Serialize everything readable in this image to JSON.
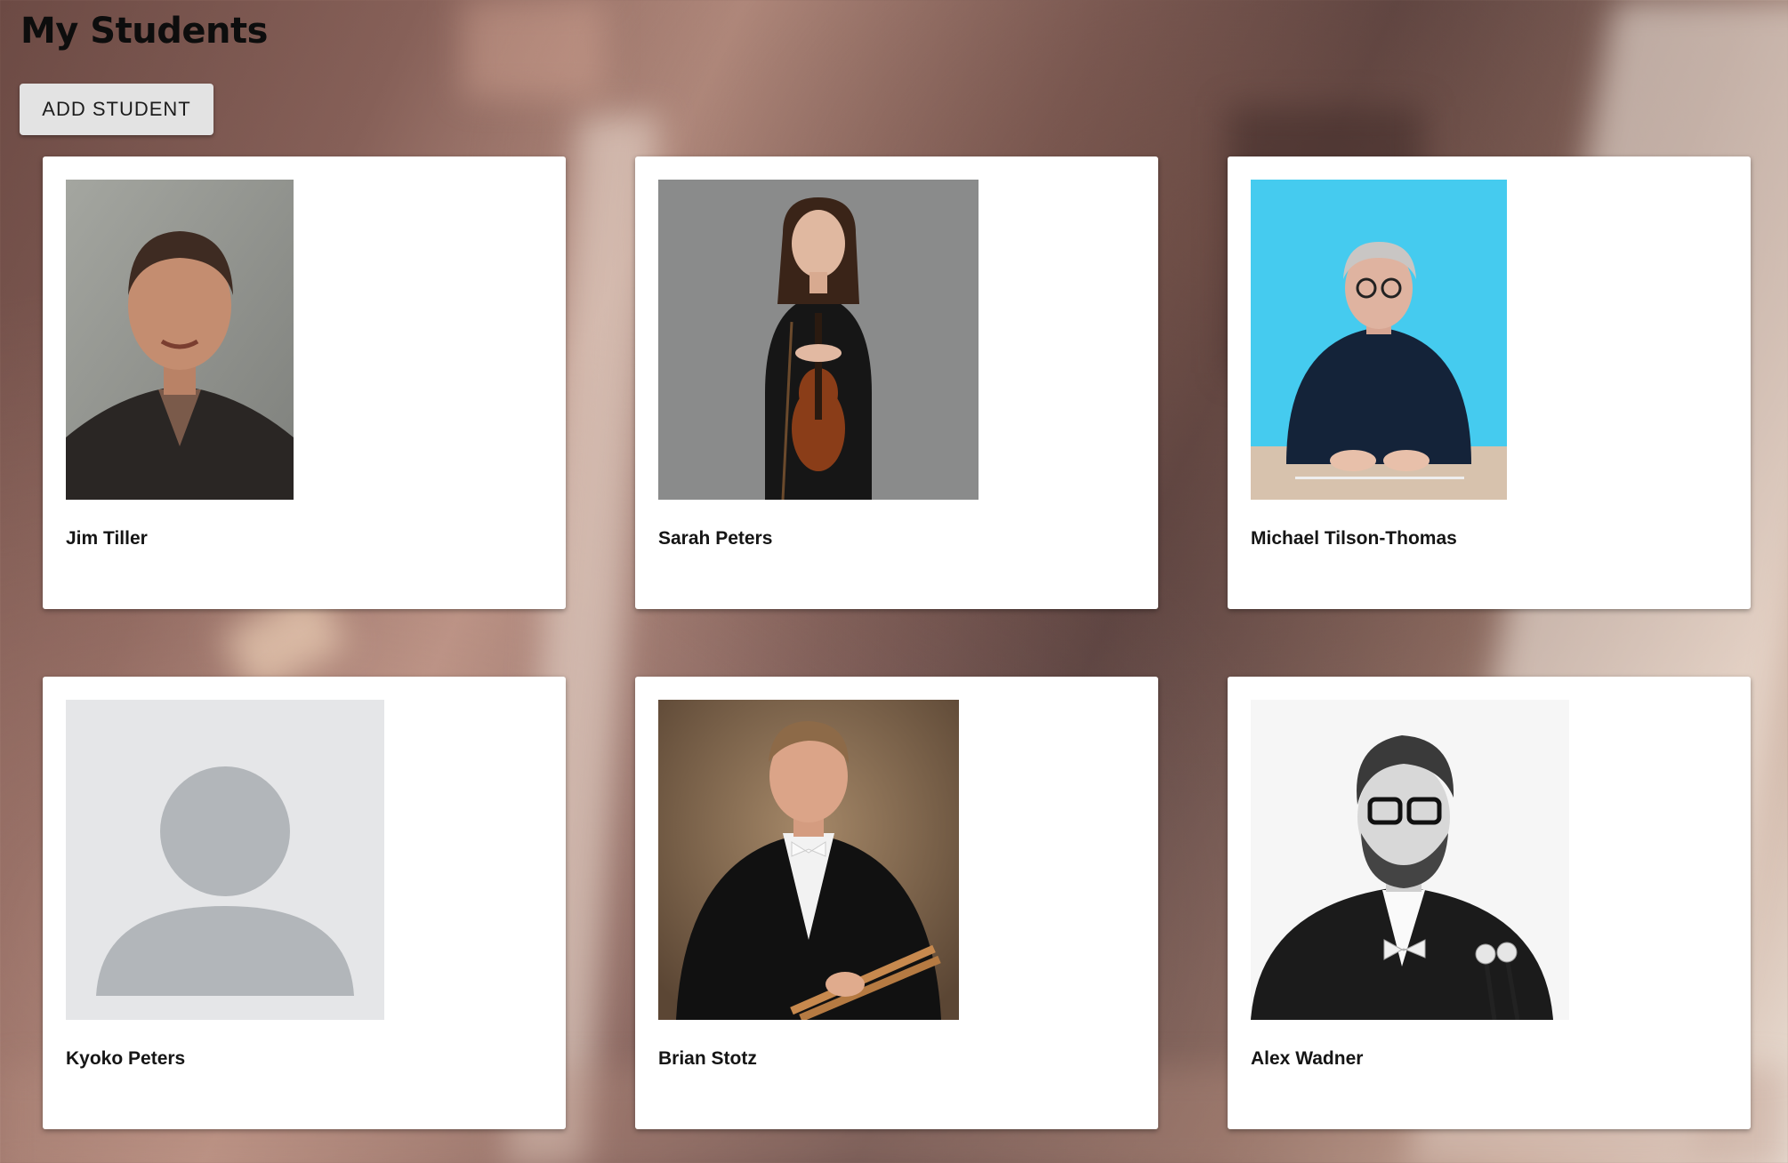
{
  "page": {
    "title": "My Students",
    "add_button_label": "ADD STUDENT"
  },
  "students": [
    {
      "name": "Jim Tiller",
      "photo": "portrait-photo"
    },
    {
      "name": "Sarah Peters",
      "photo": "violinist-portrait-photo"
    },
    {
      "name": "Michael Tilson-Thomas",
      "photo": "portrait-photo"
    },
    {
      "name": "Kyoko Peters",
      "photo": "default-avatar-icon"
    },
    {
      "name": "Brian Stotz",
      "photo": "percussionist-portrait-photo"
    },
    {
      "name": "Alex Wadner",
      "photo": "percussionist-portrait-photo"
    }
  ]
}
